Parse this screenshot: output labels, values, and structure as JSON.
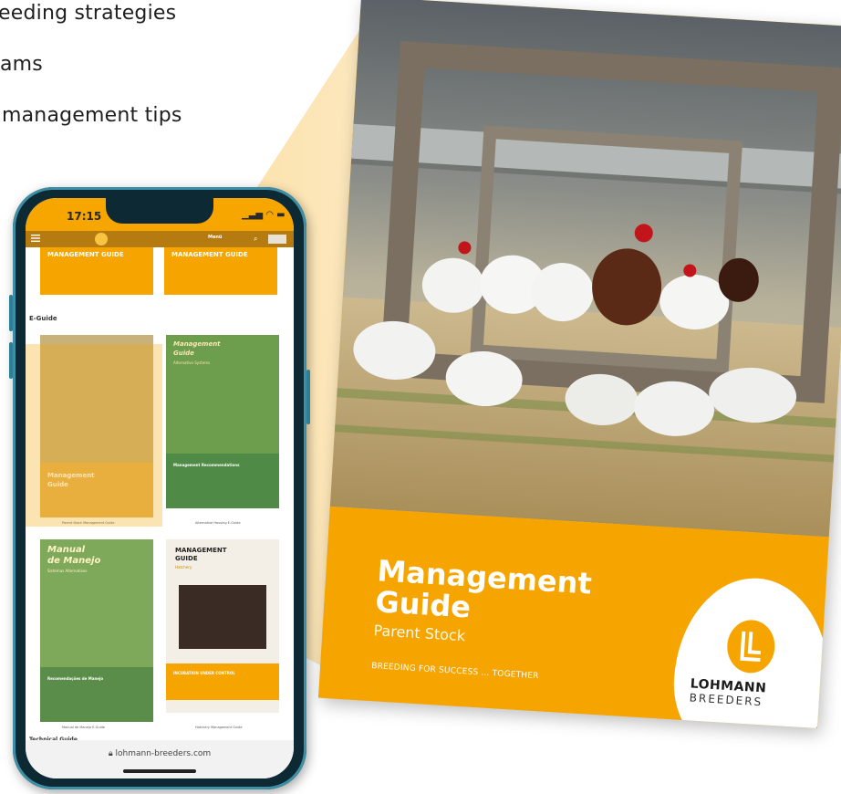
{
  "bullets": {
    "item1": "eeding strategies",
    "item2": "ams",
    "item3": "management tips"
  },
  "brochure": {
    "title_line1": "Management",
    "title_line2": "Guide",
    "subtitle": "Parent Stock",
    "tagline": "BREEDING FOR SUCCESS … TOGETHER",
    "brand_line1": "LOHMANN",
    "brand_line2": "BREEDERS"
  },
  "phone": {
    "time": "17:15",
    "status_icons": " ▁▃▅ ◠ ▬",
    "nav_label": "Menü",
    "card1_title": "MANAGEMENT GUIDE",
    "card2_title": "MANAGEMENT GUIDE",
    "section_eguide": "E-Guide",
    "card3_title": "Management",
    "card3_title2": "Guide",
    "card4_title": "Management",
    "card4_title2": "Guide",
    "card4_sub": "Alternative Systems",
    "card4_green": "Management Recommendations",
    "caption3": "Parent Stock Management Guide",
    "caption4": "Alternative Housing E-Guide",
    "card5_title": "Manual",
    "card5_title2": "de Manejo",
    "card5_sub": "Sistemas Alternativos",
    "card5_green": "Recomendações de Manejo",
    "card6_title": "MANAGEMENT",
    "card6_title2": "GUIDE",
    "card6_sub": "Hatchery",
    "card6_band": "INCUBATION UNDER CONTROL",
    "caption5": "Manual de Manejo E-Guide",
    "caption6": "Hatchery Management Guide",
    "section_technical": "Technical Guide",
    "url": "lohmann-breeders.com"
  },
  "colors": {
    "brand_orange": "#f6a500",
    "phone_frame": "#0d2a34",
    "phone_accent": "#3d8fa5",
    "green": "#5f9a55"
  }
}
